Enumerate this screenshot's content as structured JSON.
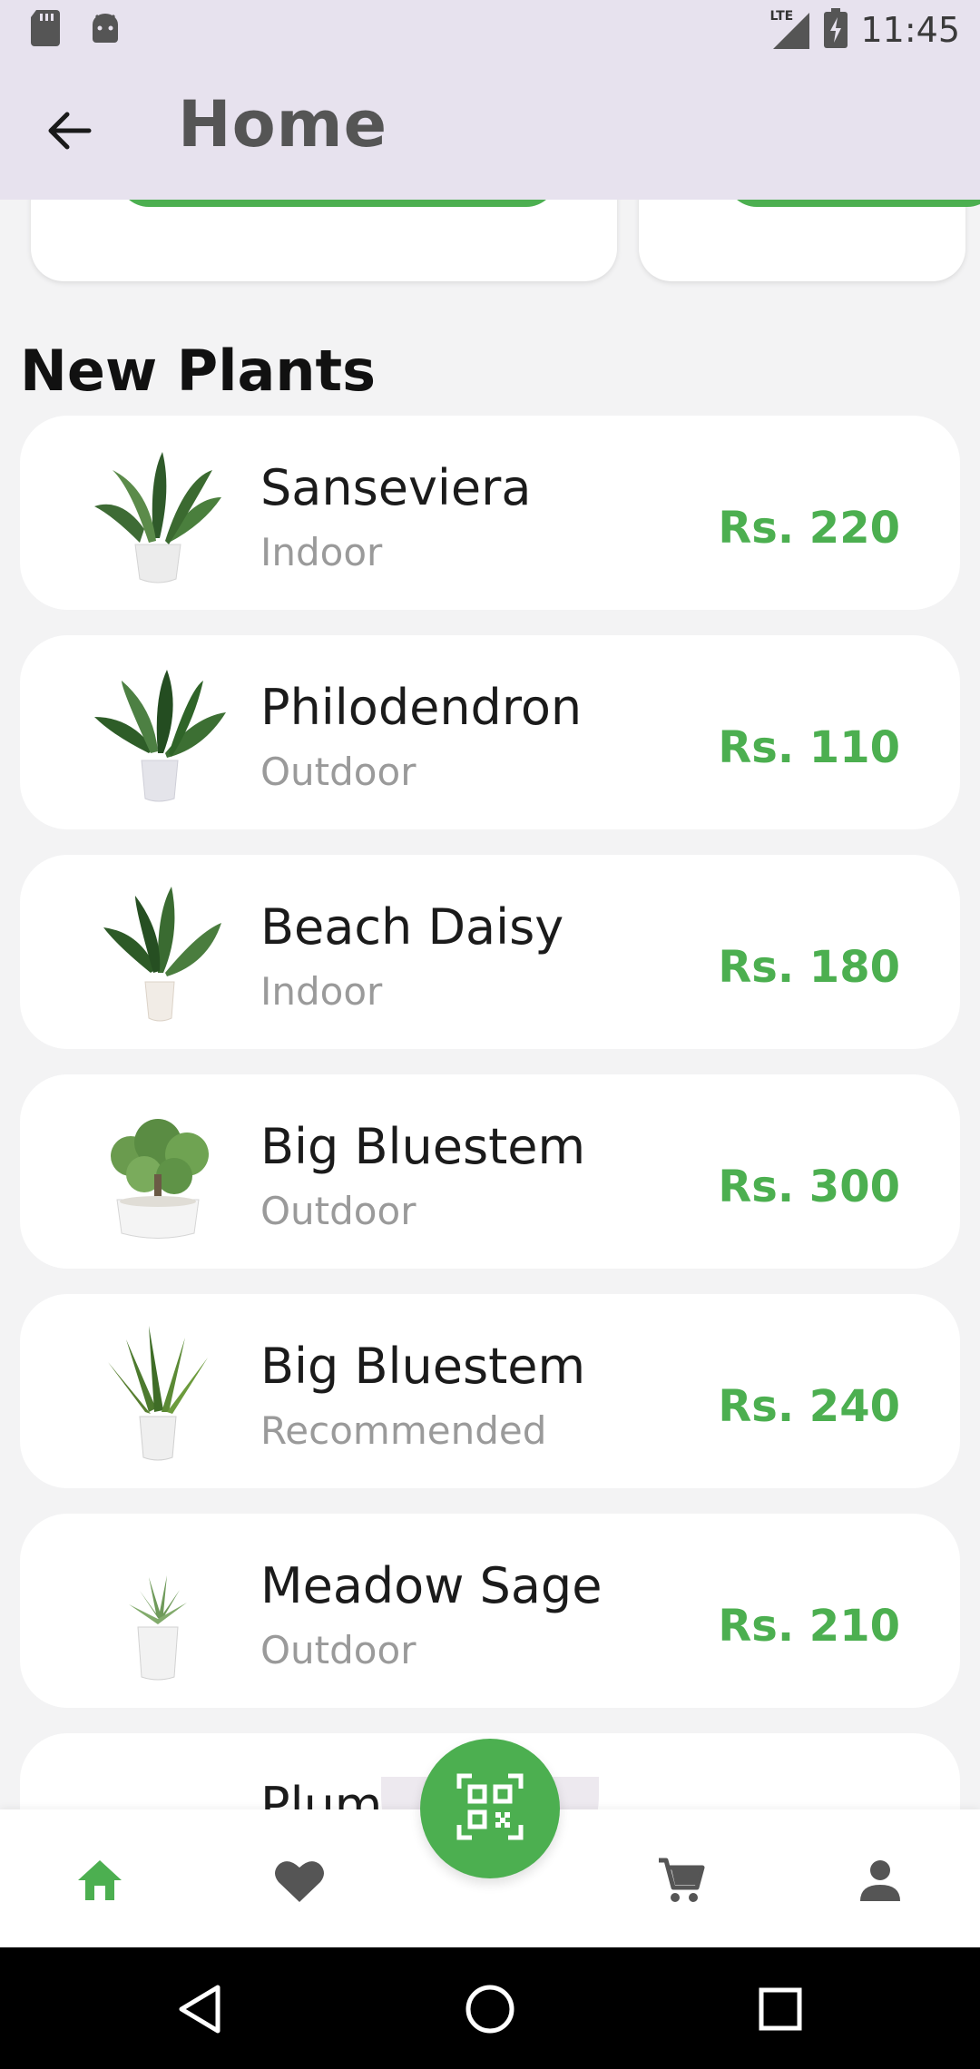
{
  "status_bar": {
    "time": "11:45",
    "network": "LTE",
    "icons": [
      "sd-card-icon",
      "android-icon",
      "signal-icon",
      "battery-charging-icon"
    ]
  },
  "app_bar": {
    "title": "Home",
    "back_icon": "arrow-back-icon"
  },
  "section": {
    "title": "New Plants"
  },
  "plants": [
    {
      "name": "Sanseviera",
      "category": "Indoor",
      "price": "Rs. 220"
    },
    {
      "name": "Philodendron",
      "category": "Outdoor",
      "price": "Rs. 110"
    },
    {
      "name": "Beach Daisy",
      "category": "Indoor",
      "price": "Rs. 180"
    },
    {
      "name": "Big Bluestem",
      "category": "Outdoor",
      "price": "Rs. 300"
    },
    {
      "name": "Big Bluestem",
      "category": "Recommended",
      "price": "Rs. 240"
    },
    {
      "name": "Meadow Sage",
      "category": "Outdoor",
      "price": "Rs. 210"
    },
    {
      "name": "Plumb",
      "category": "",
      "price": ""
    }
  ],
  "bottom_nav": {
    "items": [
      "home-icon",
      "favorite-icon",
      "qr-scan-icon",
      "cart-icon",
      "profile-icon"
    ],
    "active": "home-icon"
  },
  "colors": {
    "accent": "#4caf50",
    "app_bar_bg": "#e7e2ee",
    "background": "#f3f3f4",
    "inactive_icon": "#555555"
  }
}
